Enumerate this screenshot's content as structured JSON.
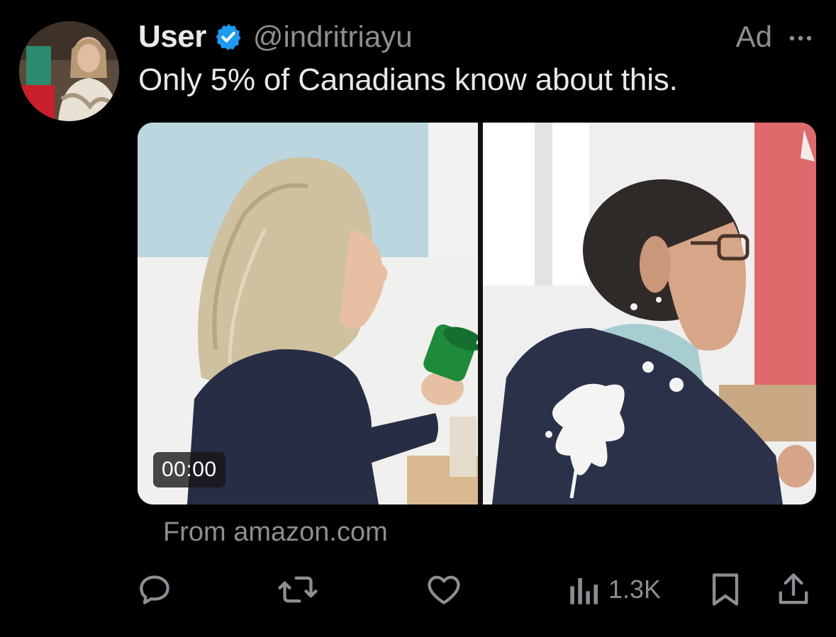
{
  "post": {
    "display_name": "User",
    "handle": "@indritriayu",
    "ad_label": "Ad",
    "text": "Only 5% of Canadians know about this.",
    "media": {
      "video_time": "00:00"
    },
    "source": "From amazon.com",
    "views": "1.3K"
  },
  "icons": {
    "verified": "verified-badge-icon",
    "more": "more-dots-icon",
    "reply": "reply-icon",
    "repost": "repost-icon",
    "like": "heart-icon",
    "views": "views-chart-icon",
    "bookmark": "bookmark-icon",
    "share": "share-icon"
  },
  "colors": {
    "background": "#000000",
    "primary_text": "#e7e9ea",
    "secondary_text": "#8b8f94",
    "verified_blue": "#1d9bf0"
  }
}
